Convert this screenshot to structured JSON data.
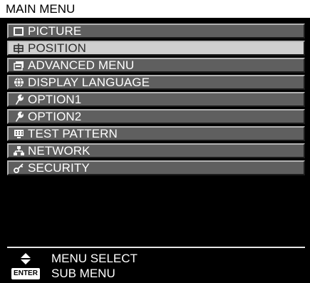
{
  "header": {
    "title": "MAIN MENU"
  },
  "menu": {
    "items": [
      {
        "label": "PICTURE",
        "icon": "picture-icon",
        "selected": false
      },
      {
        "label": "POSITION",
        "icon": "position-icon",
        "selected": true
      },
      {
        "label": "ADVANCED MENU",
        "icon": "advanced-menu-icon",
        "selected": false
      },
      {
        "label": "DISPLAY LANGUAGE",
        "icon": "globe-icon",
        "selected": false
      },
      {
        "label": "OPTION1",
        "icon": "wrench-icon",
        "selected": false
      },
      {
        "label": "OPTION2",
        "icon": "wrench-icon",
        "selected": false
      },
      {
        "label": "TEST PATTERN",
        "icon": "test-pattern-icon",
        "selected": false
      },
      {
        "label": "NETWORK",
        "icon": "network-icon",
        "selected": false
      },
      {
        "label": "SECURITY",
        "icon": "key-icon",
        "selected": false
      }
    ]
  },
  "footer": {
    "select_label": "MENU SELECT",
    "submenu_label": "SUB MENU",
    "enter_badge": "ENTER",
    "select_icon": "up-down-arrows-icon"
  },
  "colors": {
    "background": "#000000",
    "header_bg": "#ffffff",
    "item_bg": "#5f5f5f",
    "selected_bg": "#cfcfcf",
    "text": "#ffffff"
  }
}
